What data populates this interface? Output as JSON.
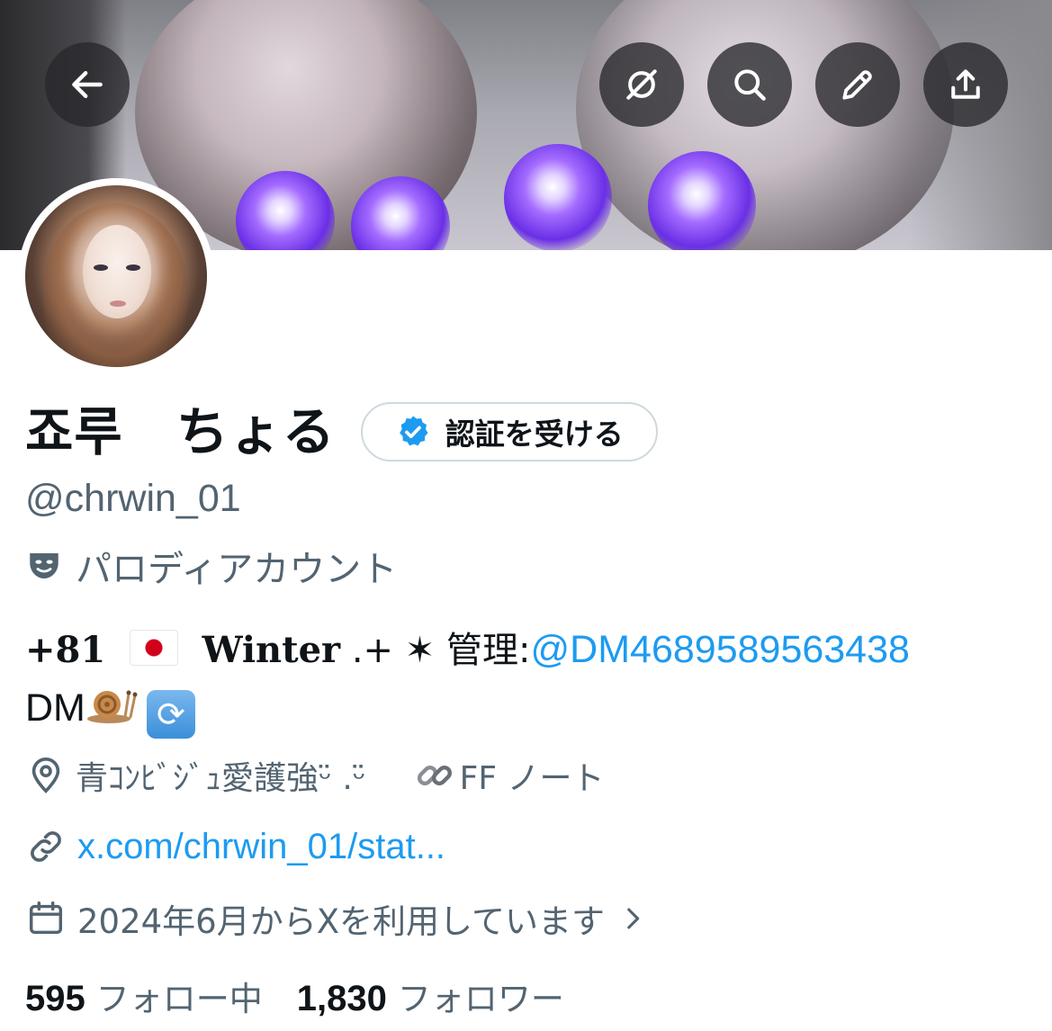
{
  "header": {
    "back_icon": "arrow-left-icon",
    "actions": [
      "grok-icon",
      "search-icon",
      "edit-icon",
      "share-icon"
    ]
  },
  "profile": {
    "display_name": "죠루　ちょる",
    "verify_label": "認証を受ける",
    "handle": "@chrwin_01",
    "parody_label": "パロディアカウント",
    "bio": {
      "country_code": "+81",
      "name_styled": "Winter",
      "sparkle": ".+ ✶",
      "manage_label": "管理:",
      "manage_mention": "@DM4689589563438",
      "dm_label": "DM",
      "dm_emoji": "snail",
      "cycle_emoji": "🔄"
    },
    "location": "青ｺﾝﾋﾞｼﾞｭ愛護強ᵕ̈ .ᵕ̈",
    "ff_note": "FF ノート",
    "link": "x.com/chrwin_01/stat...",
    "joined": "2024年6月からXを利用しています",
    "following_count": "595",
    "following_label": "フォロー中",
    "followers_count": "1,830",
    "followers_label": "フォロワー"
  },
  "colors": {
    "accent": "#1d9bf0",
    "secondary_text": "#536471",
    "primary_text": "#0f1419"
  }
}
